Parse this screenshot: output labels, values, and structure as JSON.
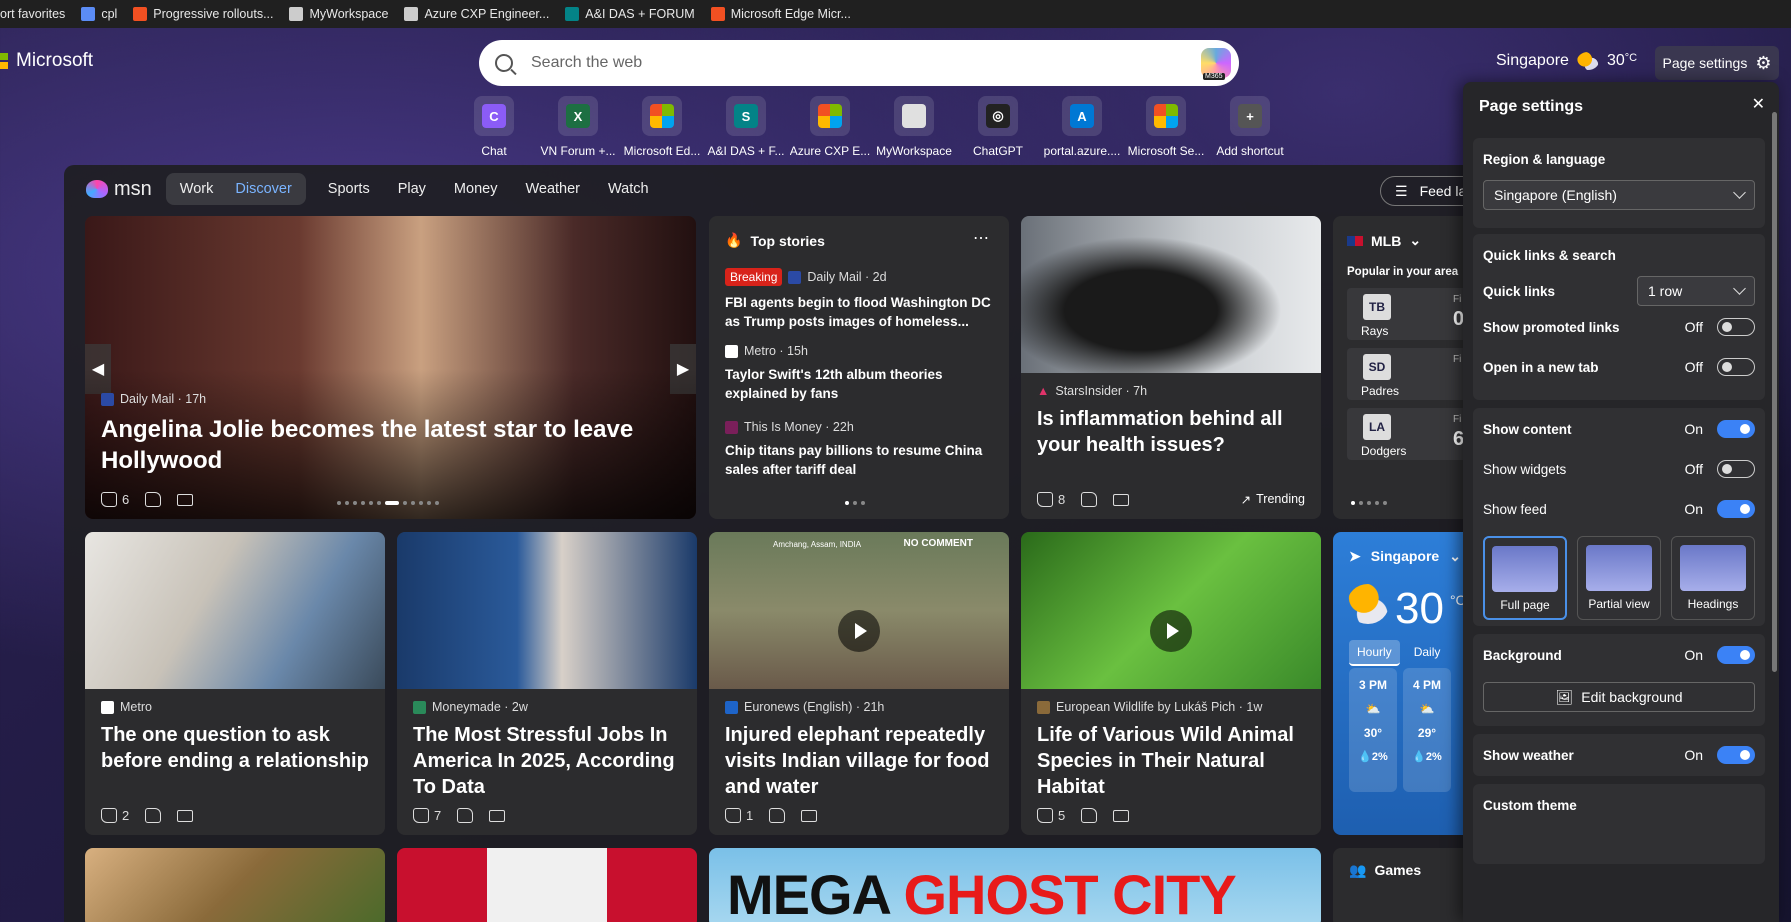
{
  "favbar": {
    "items": [
      {
        "label": "ort favorites",
        "icon": "none",
        "color": ""
      },
      {
        "label": "cpl",
        "icon": "copilot-icon",
        "color": "#5b8cf5"
      },
      {
        "label": "Progressive rollouts...",
        "icon": "ms-logo-icon",
        "color": "#f25022"
      },
      {
        "label": "MyWorkspace",
        "icon": "page-icon",
        "color": "#ccc"
      },
      {
        "label": "Azure CXP Engineer...",
        "icon": "globe-icon",
        "color": "#ccc"
      },
      {
        "label": "A&I DAS + FORUM",
        "icon": "sharepoint-icon",
        "color": "#038387"
      },
      {
        "label": "Microsoft Edge Micr...",
        "icon": "ms-logo-icon",
        "color": "#f25022"
      }
    ]
  },
  "header": {
    "brand": "Microsoft",
    "search_placeholder": "Search the web",
    "m365_badge": "M365",
    "location": "Singapore",
    "temp": "30",
    "temp_unit": "°C",
    "page_settings_label": "Page settings"
  },
  "shortcuts": [
    {
      "label": "Chat",
      "icon": "copilot-icon",
      "color": "#8b5cf6",
      "glyph": "C"
    },
    {
      "label": "VN Forum +...",
      "icon": "excel-icon",
      "color": "#1d6f42",
      "glyph": "X"
    },
    {
      "label": "Microsoft Ed...",
      "icon": "ms-logo-icon",
      "color": "#f25022",
      "glyph": ""
    },
    {
      "label": "A&I DAS + F...",
      "icon": "sharepoint-icon",
      "color": "#038387",
      "glyph": "S"
    },
    {
      "label": "Azure CXP E...",
      "icon": "ms-logo-icon",
      "color": "#f25022",
      "glyph": ""
    },
    {
      "label": "MyWorkspace",
      "icon": "page-icon",
      "color": "#e0e0e0",
      "glyph": ""
    },
    {
      "label": "ChatGPT",
      "icon": "chatgpt-icon",
      "color": "#222",
      "glyph": "◎"
    },
    {
      "label": "portal.azure....",
      "icon": "azure-icon",
      "color": "#0078d4",
      "glyph": "A"
    },
    {
      "label": "Microsoft Se...",
      "icon": "ms-logo-icon",
      "color": "#f25022",
      "glyph": ""
    },
    {
      "label": "Add shortcut",
      "icon": "plus-icon",
      "color": "#555",
      "glyph": "+"
    }
  ],
  "nav": {
    "msn": "msn",
    "work": "Work",
    "discover": "Discover",
    "items": [
      "Sports",
      "Play",
      "Money",
      "Weather",
      "Watch"
    ],
    "feed_layout": "Feed la"
  },
  "hero": {
    "source": "Daily Mail · 17h",
    "title": "Angelina Jolie becomes the latest star to leave Hollywood",
    "likes": "6"
  },
  "top_stories": {
    "heading": "Top stories",
    "stories": [
      {
        "badge": "Breaking",
        "source": "Daily Mail · 2d",
        "title": "FBI agents begin to flood Washington DC as Trump posts images of homeless..."
      },
      {
        "badge": "",
        "source": "Metro · 15h",
        "title": "Taylor Swift's 12th album theories explained by fans"
      },
      {
        "badge": "",
        "source": "This Is Money · 22h",
        "title": "Chip titans pay billions to resume China sales after tariff deal"
      }
    ]
  },
  "inflammation": {
    "source": "StarsInsider · 7h",
    "title": "Is inflammation behind all your health issues?",
    "likes": "8",
    "trending": "Trending"
  },
  "mlb": {
    "heading": "MLB",
    "sub": "Popular in your area",
    "teams": [
      {
        "name": "Rays",
        "abbr": "TB",
        "score": "0"
      },
      {
        "name": "Padres",
        "abbr": "SD",
        "score": ""
      },
      {
        "name": "Dodgers",
        "abbr": "LA",
        "score": "6"
      }
    ],
    "fin": "Fi"
  },
  "row2": [
    {
      "source": "Metro",
      "title": "The one question to ask before ending a relationship",
      "likes": "2",
      "video": false
    },
    {
      "source": "Moneymade · 2w",
      "title": "The Most Stressful Jobs In America In 2025, According To Data",
      "likes": "7",
      "video": false
    },
    {
      "source": "Euronews (English) · 21h",
      "title": "Injured elephant repeatedly visits Indian village for food and water",
      "likes": "1",
      "video": true,
      "overlay": "Amchang, Assam, INDIA",
      "brand": "NO COMMENT"
    },
    {
      "source": "European Wildlife by Lukáš Pich · 1w",
      "title": "Life of Various Wild Animal Species in Their Natural Habitat",
      "likes": "5",
      "video": true
    }
  ],
  "weather": {
    "city": "Singapore",
    "temp": "30",
    "unit": "°C",
    "tabs": [
      "Hourly",
      "Daily"
    ],
    "hours": [
      {
        "time": "3 PM",
        "temp": "30°",
        "rain": "2%"
      },
      {
        "time": "4 PM",
        "temp": "29°",
        "rain": "2%"
      }
    ]
  },
  "row3": {
    "banner_a": "MEGA",
    "banner_b": "GHOST CITY",
    "games": "Games"
  },
  "settings": {
    "title": "Page settings",
    "region_heading": "Region & language",
    "region_value": "Singapore (English)",
    "quick_heading": "Quick links & search",
    "quick_links": "Quick links",
    "quick_links_value": "1 row",
    "promoted": "Show promoted links",
    "promoted_state": "Off",
    "newtab": "Open in a new tab",
    "newtab_state": "Off",
    "content": "Show content",
    "content_state": "On",
    "widgets": "Show widgets",
    "widgets_state": "Off",
    "feed": "Show feed",
    "feed_state": "On",
    "layouts": [
      "Full page",
      "Partial view",
      "Headings"
    ],
    "background": "Background",
    "background_state": "On",
    "edit_background": "Edit background",
    "weather": "Show weather",
    "weather_state": "On",
    "custom_theme": "Custom theme"
  }
}
